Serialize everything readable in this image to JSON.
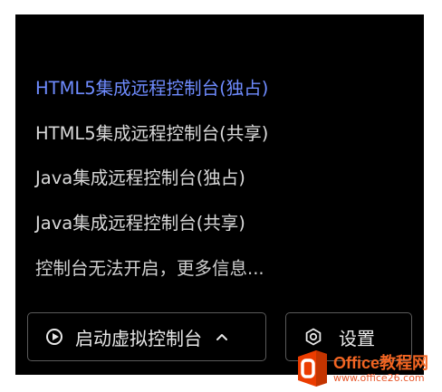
{
  "menu": {
    "items": [
      {
        "label": "HTML5集成远程控制台(独占)"
      },
      {
        "label": "HTML5集成远程控制台(共享)"
      },
      {
        "label": "Java集成远程控制台(独占)"
      },
      {
        "label": "Java集成远程控制台(共享)"
      },
      {
        "label": "控制台无法开启，更多信息..."
      }
    ]
  },
  "buttons": {
    "launch_label": "启动虚拟控制台",
    "settings_label": "设置"
  },
  "icons": {
    "launch": "play-circle-icon",
    "dropdown": "chevron-up-icon",
    "settings": "hexagon-gear-icon"
  },
  "watermark": {
    "title": "Office教程网",
    "subtitle": "www.office26.com"
  },
  "colors": {
    "background": "#000000",
    "active_item": "#6f8cff",
    "text": "#d9d9d9",
    "button_border": "#5a5a5a",
    "watermark": "#f26522"
  }
}
